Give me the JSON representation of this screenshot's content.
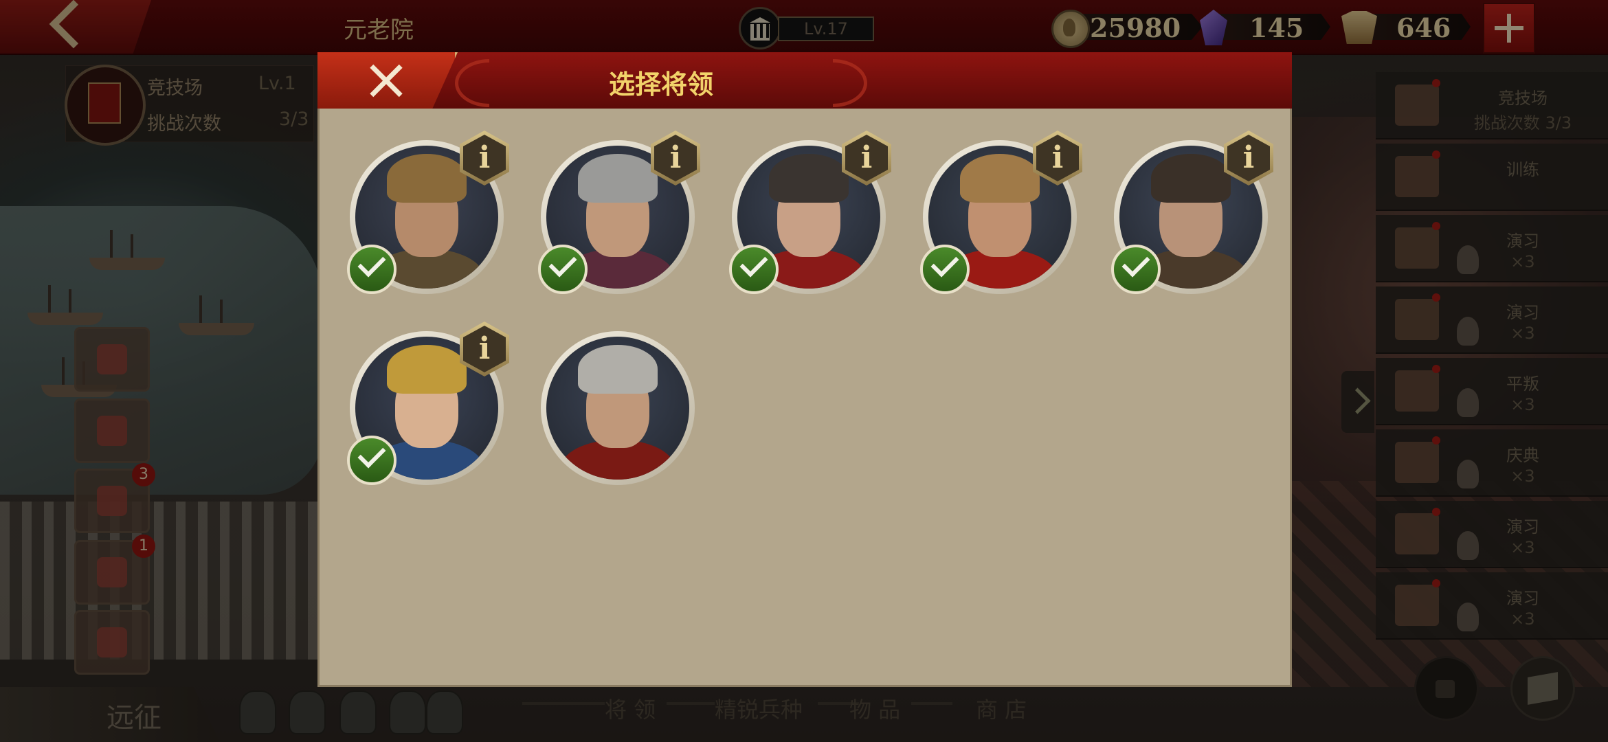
{
  "topbar": {
    "title": "元老院",
    "level": "Lv.17",
    "coins": "25980",
    "gems": "145",
    "spqr": "646",
    "icons": [
      "back-arrow-icon",
      "senate-building-icon",
      "coin-icon",
      "gem-icon",
      "spqr-icon",
      "plus-icon"
    ]
  },
  "arena": {
    "name": "竞技场",
    "level": "Lv.1",
    "tries_label": "挑战次数",
    "tries": "3/3"
  },
  "left_buttons": [
    {
      "icon": "money-bag-icon"
    },
    {
      "icon": "laurel-crown-icon"
    },
    {
      "icon": "film-icon",
      "badge": "3"
    },
    {
      "icon": "treasure-chest-icon",
      "badge": "1"
    },
    {
      "icon": "trophy-icon"
    }
  ],
  "expedition": {
    "label": "远征"
  },
  "bottom_nav": [
    "将 领",
    "精锐兵种",
    "物 品",
    "商 店"
  ],
  "right_panel": [
    {
      "title": "竞技场",
      "sub": "挑战次数 3/3",
      "icon": "crossed-swords-icon"
    },
    {
      "title": "训练",
      "sub": "",
      "icon": "helmet-icon"
    },
    {
      "title": "演习",
      "sub": "×3",
      "icon": "banner-icon"
    },
    {
      "title": "演习",
      "sub": "×3",
      "icon": "banner-icon"
    },
    {
      "title": "平叛",
      "sub": "×3",
      "icon": "mask-icon"
    },
    {
      "title": "庆典",
      "sub": "×3",
      "icon": "temple-icon"
    },
    {
      "title": "演习",
      "sub": "×3",
      "icon": "banner-icon"
    },
    {
      "title": "演习",
      "sub": "×3",
      "icon": "banner-icon"
    }
  ],
  "modal": {
    "title": "选择将领",
    "info_glyph": "i",
    "generals": [
      {
        "id": "general-1",
        "selected": true,
        "has_info": true,
        "skin": "#b58a6a",
        "helmet": "#8a6a3a",
        "cloth": "#5a4a30",
        "bg": "#3c4252"
      },
      {
        "id": "general-2",
        "selected": true,
        "has_info": true,
        "skin": "#c0987a",
        "helmet": "#9a9a98",
        "cloth": "#5a2a3a",
        "bg": "#3a4050"
      },
      {
        "id": "general-3",
        "selected": true,
        "has_info": true,
        "skin": "#c8a086",
        "helmet": "#3a3430",
        "cloth": "#8a1a18",
        "bg": "#3c4454"
      },
      {
        "id": "general-4",
        "selected": true,
        "has_info": true,
        "skin": "#c09070",
        "helmet": "#a07a48",
        "cloth": "#9a1a14",
        "bg": "#3a4250"
      },
      {
        "id": "general-5",
        "selected": true,
        "has_info": true,
        "skin": "#b89278",
        "helmet": "#3a3028",
        "cloth": "#4a3a2a",
        "bg": "#3e4656"
      },
      {
        "id": "general-6",
        "selected": true,
        "has_info": true,
        "skin": "#d8b090",
        "helmet": "#c09a3a",
        "cloth": "#2a4a7a",
        "bg": "#3a4254"
      },
      {
        "id": "general-7",
        "selected": false,
        "has_info": false,
        "skin": "#c0987a",
        "helmet": "#b0aea8",
        "cloth": "#7a1a14",
        "bg": "#3a4252"
      }
    ]
  }
}
